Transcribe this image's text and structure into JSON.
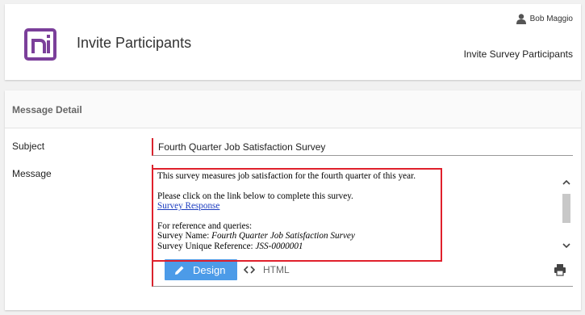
{
  "header": {
    "title": "Invite Participants",
    "user_name": "Bob Maggio",
    "subtitle": "Invite Survey Participants",
    "brand_color": "#7b3f9a"
  },
  "detail": {
    "section_title": "Message Detail",
    "subject_label": "Subject",
    "subject_value": "Fourth Quarter Job Satisfaction Survey",
    "message_label": "Message",
    "message": {
      "line1": "This survey measures job satisfaction for the fourth quarter of this year.",
      "line2": "Please click on the link below to complete this survey.",
      "link": "Survey Response",
      "line3": "For reference and queries:",
      "name_label": "Survey Name: ",
      "name_value": "Fourth Quarter Job Satisfaction Survey",
      "ref_label": "Survey Unique Reference: ",
      "ref_value": "JSS-0000001"
    },
    "tabs": {
      "design": "Design",
      "html": "HTML"
    },
    "accent_color": "#4c9be8",
    "required_color": "#d9232d"
  }
}
